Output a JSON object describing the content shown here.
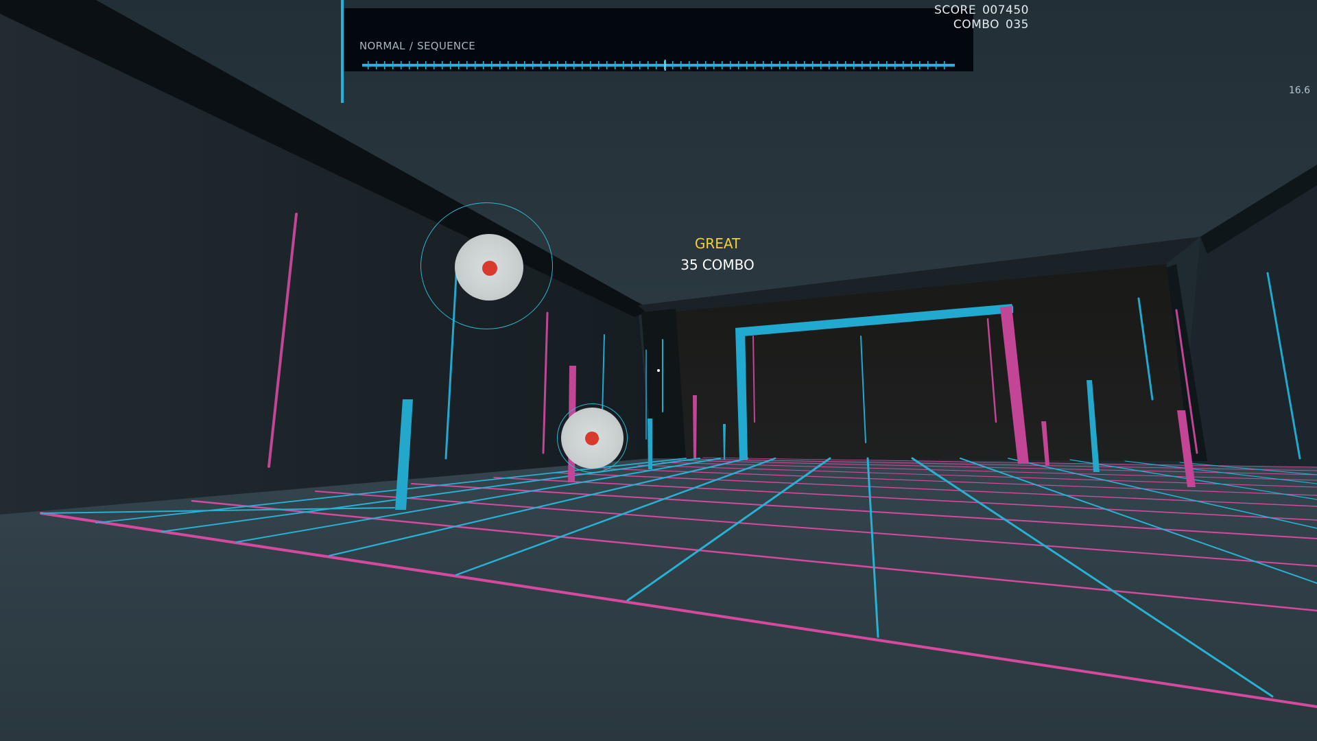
{
  "hud": {
    "difficulty": "NORMAL",
    "separator": "/",
    "mode": "SEQUENCE",
    "progress": 0.51,
    "score_label": "SCORE",
    "score_value": "007450",
    "combo_label": "COMBO",
    "combo_value": "035",
    "fps": "16.6"
  },
  "feedback": {
    "judgement": "GREAT",
    "combo_count": "35",
    "combo_word": "COMBO"
  },
  "colors": {
    "cyan": "#22b3d8",
    "magenta": "#d54a9f",
    "judgement": "#f2cf3c",
    "target_core": "#d93a2e"
  },
  "icons": {
    "target": "bullseye-target-icon",
    "crosshair": "crosshair-dot-icon"
  }
}
